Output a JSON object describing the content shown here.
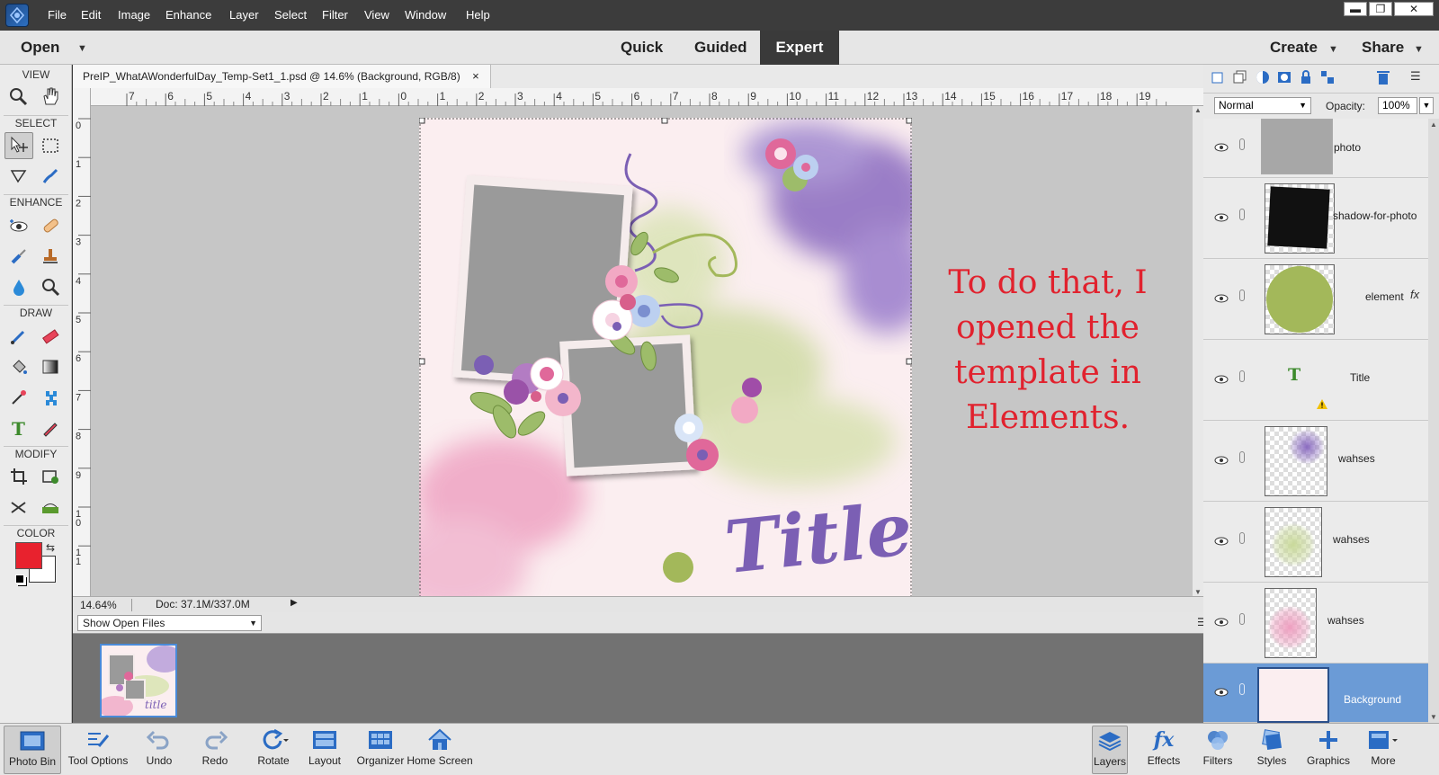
{
  "menubar": {
    "items": [
      "File",
      "Edit",
      "Image",
      "Enhance",
      "Layer",
      "Select",
      "Filter",
      "View",
      "Window",
      "Help"
    ]
  },
  "modebar": {
    "open_label": "Open",
    "modes": [
      "Quick",
      "Guided",
      "Expert"
    ],
    "create_label": "Create",
    "share_label": "Share"
  },
  "toolbox": {
    "sections": [
      "VIEW",
      "SELECT",
      "ENHANCE",
      "DRAW",
      "MODIFY",
      "COLOR"
    ],
    "foreground_color": "#e8222e",
    "background_color": "#ffffff"
  },
  "document": {
    "tab_title": "PreIP_WhatAWonderfulDay_Temp-Set1_1.psd @ 14.6% (Background, RGB/8)",
    "close_glyph": "×",
    "ruler_top": [
      "7",
      "6",
      "5",
      "4",
      "3",
      "2",
      "1",
      "0",
      "1",
      "2",
      "3",
      "4",
      "5",
      "6",
      "7",
      "8",
      "9",
      "10",
      "11",
      "12",
      "13",
      "14",
      "15",
      "16",
      "17",
      "18",
      "19"
    ],
    "ruler_left": [
      "0",
      "1",
      "2",
      "3",
      "4",
      "5",
      "6",
      "7",
      "8",
      "9",
      "1\n0",
      "1\n1"
    ]
  },
  "artwork": {
    "title_text": "Title"
  },
  "caption": {
    "text": "To do that, I opened the template in Elements."
  },
  "status": {
    "zoom": "14.64%",
    "doc_size": "Doc: 37.1M/337.0M"
  },
  "photo_bin": {
    "select_value": "Show Open Files",
    "thumb_title": "title"
  },
  "layers_panel": {
    "blend_mode": "Normal",
    "opacity_label": "Opacity:",
    "opacity_value": "100%",
    "layers": [
      {
        "name": "photo",
        "type": "gray"
      },
      {
        "name": "shadow-for-photo",
        "type": "black"
      },
      {
        "name": "element",
        "type": "green-circle",
        "fx": "fx"
      },
      {
        "name": "Title",
        "type": "text"
      },
      {
        "name": "wahses",
        "type": "purple-wash"
      },
      {
        "name": "wahses",
        "type": "green-wash"
      },
      {
        "name": "wahses",
        "type": "pink-wash"
      },
      {
        "name": "Background",
        "type": "background"
      }
    ]
  },
  "taskbar": {
    "left": [
      "Photo Bin",
      "Tool Options",
      "Undo",
      "Redo",
      "Rotate",
      "Layout",
      "Organizer",
      "Home Screen"
    ],
    "right": [
      "Layers",
      "Effects",
      "Filters",
      "Styles",
      "Graphics",
      "More"
    ]
  },
  "colors": {
    "accent_red": "#e1222e",
    "selected_layer": "#6b9bd6",
    "purple": "#7b5fb4",
    "green": "#a3b85a",
    "pink": "#e58fb3"
  }
}
